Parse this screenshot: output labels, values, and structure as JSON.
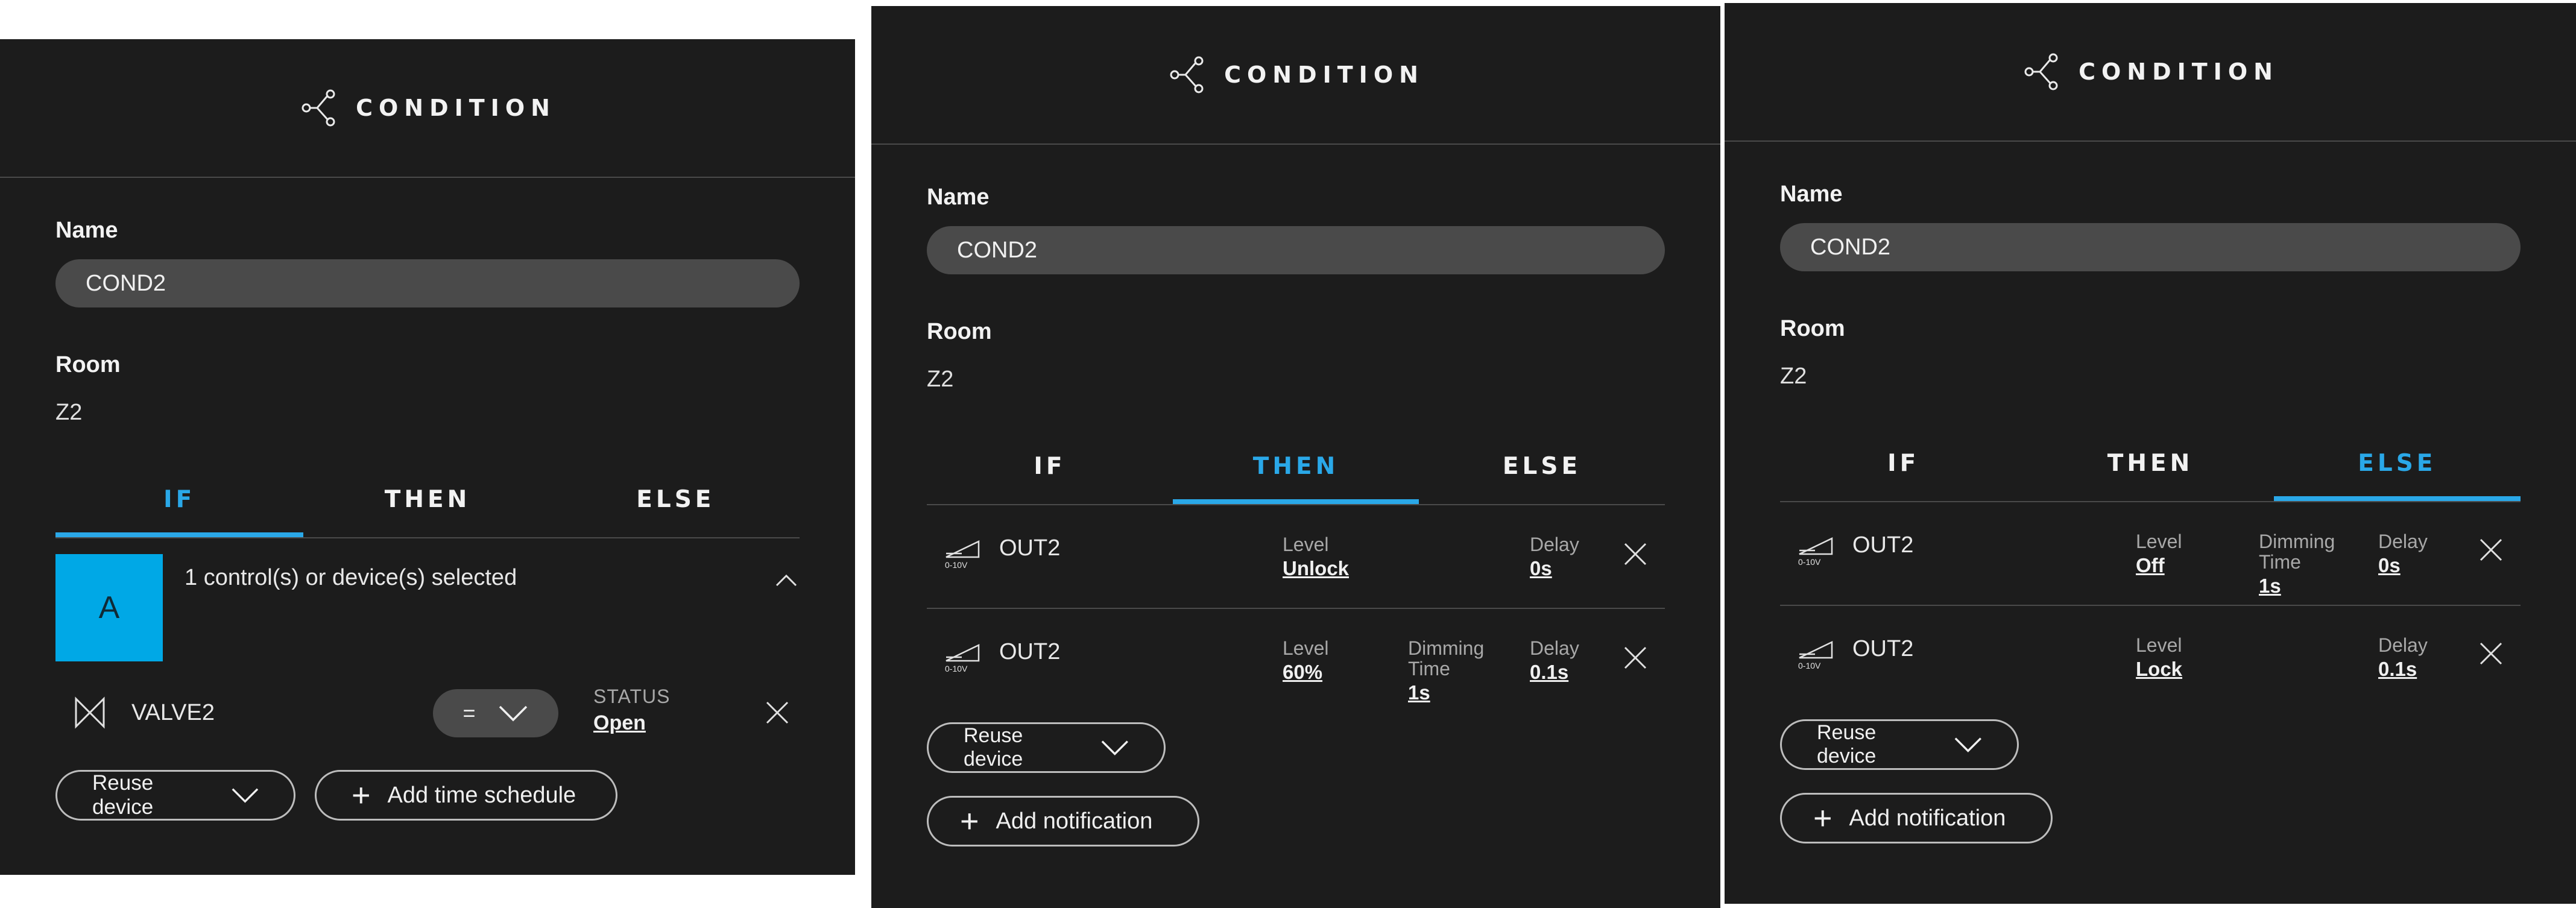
{
  "colors": {
    "panel_bg": "#1c1c1c",
    "accent": "#2aa8e8",
    "selection_tile": "#00a8e6",
    "field_bg": "#4a4a4a"
  },
  "icons": {
    "header": "branch-node-icon",
    "valve": "valve-icon",
    "dimmer": "dimmer-0-10v-icon",
    "close": "close-icon",
    "chevron_down": "chevron-down-icon",
    "chevron_up": "chevron-up-icon",
    "plus": "plus-icon"
  },
  "panels": [
    {
      "title": "CONDITION",
      "name_label": "Name",
      "name_value": "COND2",
      "room_label": "Room",
      "room_value": "Z2",
      "tabs": [
        "IF",
        "THEN",
        "ELSE"
      ],
      "active_tab": "IF",
      "selection_tile": "A",
      "selection_text": "1 control(s) or device(s) selected",
      "device_name": "VALVE2",
      "operator": "=",
      "status_label": "STATUS",
      "status_value": "Open",
      "reuse_label": "Reuse device",
      "add_schedule_label": "Add time schedule"
    },
    {
      "title": "CONDITION",
      "name_label": "Name",
      "name_value": "COND2",
      "room_label": "Room",
      "room_value": "Z2",
      "tabs": [
        "IF",
        "THEN",
        "ELSE"
      ],
      "active_tab": "THEN",
      "icon_caption": "0-10V",
      "rows": [
        {
          "device": "OUT2",
          "level_label": "Level",
          "level_value": "Unlock",
          "delay_label": "Delay",
          "delay_value": "0s"
        },
        {
          "device": "OUT2",
          "level_label": "Level",
          "level_value": "60%",
          "dimming_label": "Dimming Time",
          "dimming_value": "1s",
          "delay_label": "Delay",
          "delay_value": "0.1s"
        }
      ],
      "reuse_label": "Reuse device",
      "add_notification_label": "Add notification"
    },
    {
      "title": "CONDITION",
      "name_label": "Name",
      "name_value": "COND2",
      "room_label": "Room",
      "room_value": "Z2",
      "tabs": [
        "IF",
        "THEN",
        "ELSE"
      ],
      "active_tab": "ELSE",
      "icon_caption": "0-10V",
      "rows": [
        {
          "device": "OUT2",
          "level_label": "Level",
          "level_value": "Off",
          "dimming_label": "Dimming Time",
          "dimming_value": "1s",
          "delay_label": "Delay",
          "delay_value": "0s"
        },
        {
          "device": "OUT2",
          "level_label": "Level",
          "level_value": "Lock",
          "delay_label": "Delay",
          "delay_value": "0.1s"
        }
      ],
      "reuse_label": "Reuse device",
      "add_notification_label": "Add notification"
    }
  ]
}
